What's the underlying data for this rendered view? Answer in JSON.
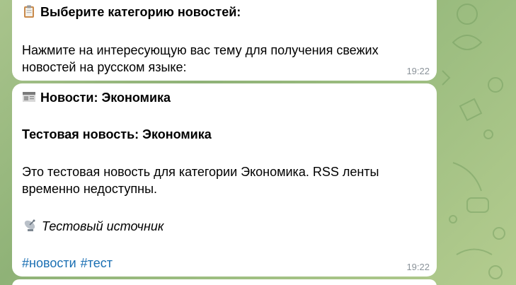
{
  "messages": [
    {
      "title": "Выберите категорию новостей:",
      "body_line1": "Нажмите на интересующую вас тему для получения свежих",
      "body_line2": "новостей на русском языке:",
      "time": "19:22"
    },
    {
      "title": "Новости: Экономика",
      "headline": "Тестовая новость: Экономика",
      "body_line1": "Это тестовая новость для категории Экономика. RSS ленты",
      "body_line2": "временно недоступны.",
      "source": "Тестовый источник",
      "hashtags": [
        "#новости",
        "#тест"
      ],
      "time": "19:22"
    }
  ],
  "icons": {
    "clipboard": "clipboard-icon",
    "newspaper": "newspaper-icon",
    "satellite": "satellite-antenna-icon"
  },
  "colors": {
    "bubble": "#ffffff",
    "hashtag": "#1a6fb3",
    "time": "#8a9299"
  }
}
